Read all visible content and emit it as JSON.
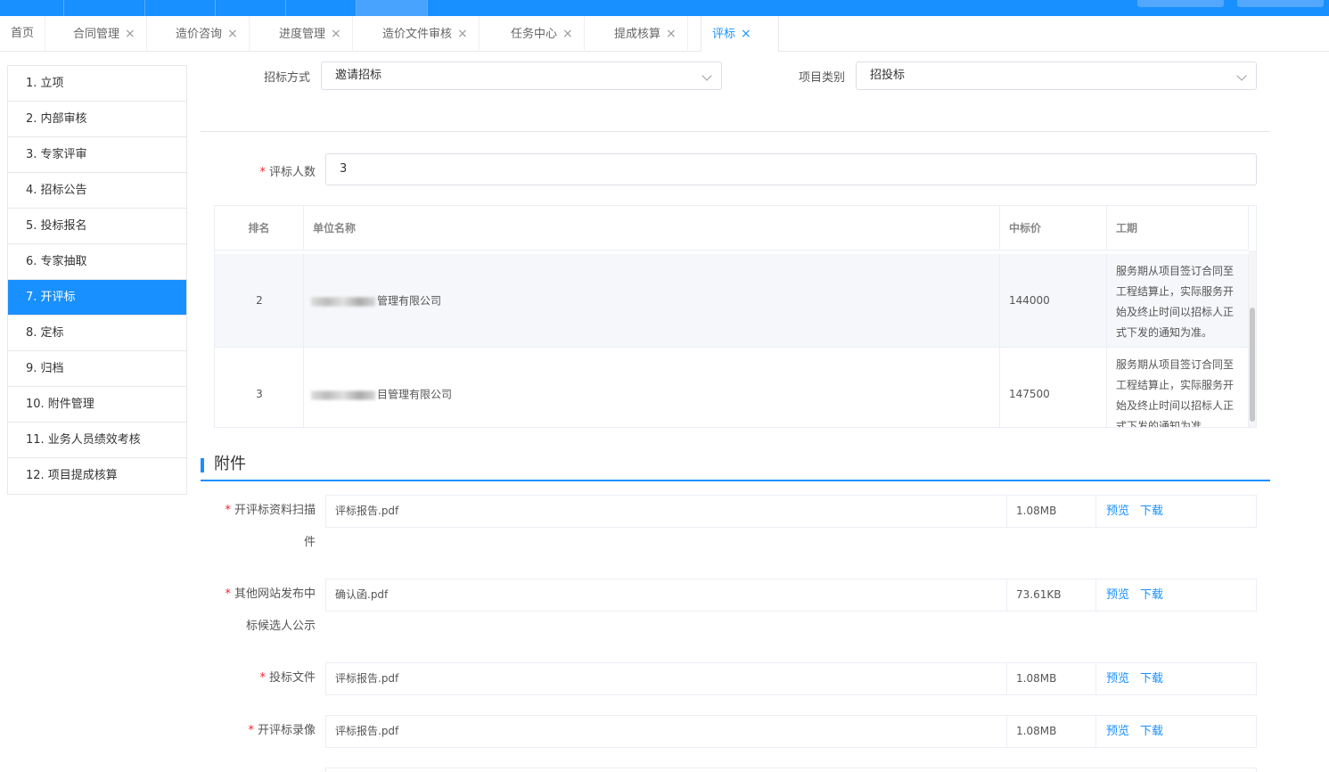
{
  "tabs": [
    {
      "label": "首页",
      "closable": false
    },
    {
      "label": "合同管理",
      "closable": true
    },
    {
      "label": "造价咨询",
      "closable": true
    },
    {
      "label": "进度管理",
      "closable": true
    },
    {
      "label": "造价文件审核",
      "closable": true
    },
    {
      "label": "任务中心",
      "closable": true
    },
    {
      "label": "提成核算",
      "closable": true
    },
    {
      "label": "评标",
      "closable": true,
      "active": true
    }
  ],
  "close_glyph": "×",
  "steps": [
    "1. 立项",
    "2. 内部审核",
    "3. 专家评审",
    "4. 招标公告",
    "5. 投标报名",
    "6. 专家抽取",
    "7. 开评标",
    "8. 定标",
    "9. 归档",
    "10. 附件管理",
    "11. 业务人员绩效考核",
    "12. 项目提成核算"
  ],
  "active_step_index": 6,
  "form": {
    "bid_method_label": "招标方式",
    "bid_method_value": "邀请招标",
    "project_type_label": "项目类别",
    "project_type_value": "招投标",
    "evaluator_count_label": "评标人数",
    "evaluator_count_value": "3"
  },
  "table": {
    "headers": {
      "rank": "排名",
      "company": "单位名称",
      "price": "中标价",
      "period": "工期"
    },
    "rows": [
      {
        "rank": "2",
        "company_visible": "管理有限公司",
        "price": "144000",
        "period": "服务期从项目签订合同至工程结算止，实际服务开始及终止时间以招标人正式下发的通知为准。"
      },
      {
        "rank": "3",
        "company_visible": "目管理有限公司",
        "price": "147500",
        "period": "服务期从项目签订合同至工程结算止，实际服务开始及终止时间以招标人正式下发的通知为准。"
      }
    ]
  },
  "attachments": {
    "title": "附件",
    "preview_label": "预览",
    "download_label": "下载",
    "items": [
      {
        "label_line1": "开评标资料扫描",
        "label_line2": "件",
        "file": "评标报告.pdf",
        "size": "1.08MB"
      },
      {
        "label_line1": "其他网站发布中",
        "label_line2": "标候选人公示",
        "file": "确认函.pdf",
        "size": "73.61KB"
      },
      {
        "label_line1": "投标文件",
        "label_line2": "",
        "file": "评标报告.pdf",
        "size": "1.08MB"
      },
      {
        "label_line1": "开评标录像",
        "label_line2": "",
        "file": "评标报告.pdf",
        "size": "1.08MB"
      }
    ]
  },
  "colors": {
    "primary": "#1890ff",
    "required": "#f5222d"
  },
  "icons": {
    "close": "close-icon",
    "dropdown": "chevron-down-icon"
  }
}
